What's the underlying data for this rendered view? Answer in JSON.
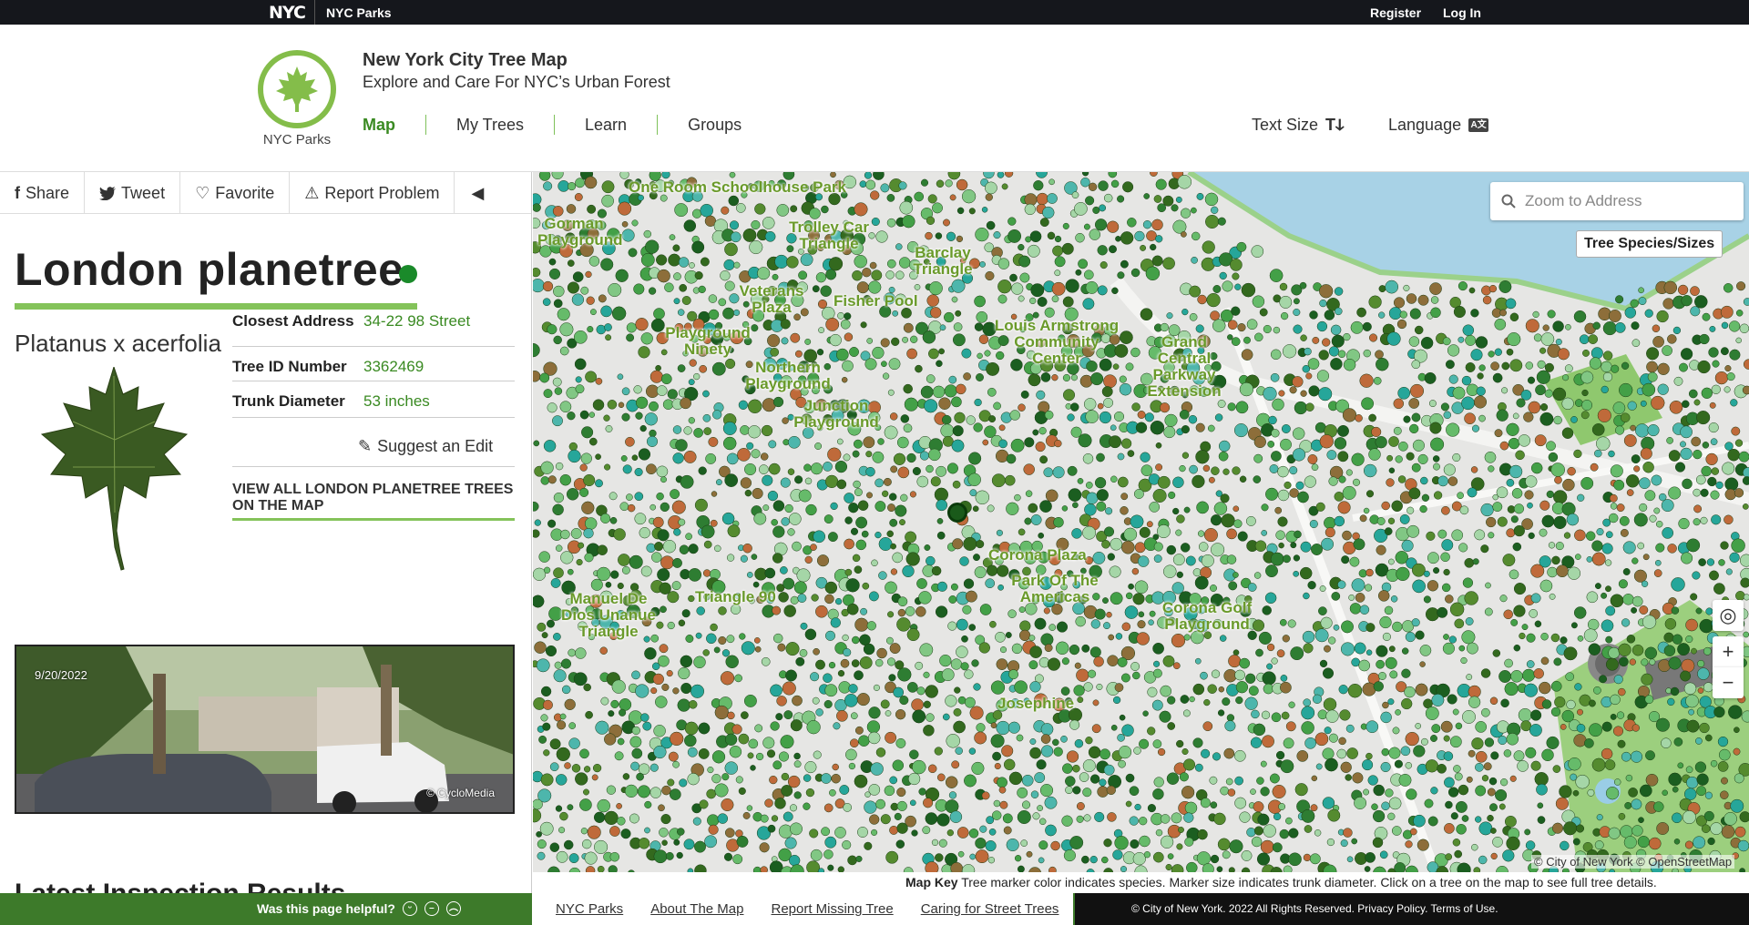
{
  "topbar": {
    "logo": "NYC",
    "parks": "NYC Parks",
    "register": "Register",
    "login": "Log In"
  },
  "header": {
    "logo_text": "NYC Parks",
    "title": "New York City Tree Map",
    "subtitle": "Explore and Care For NYC’s Urban Forest",
    "nav": [
      "Map",
      "My Trees",
      "Learn",
      "Groups"
    ],
    "active_nav": "Map",
    "text_size": "Text Size",
    "text_size_icon": "Tↆ",
    "language": "Language",
    "language_icon": "A文"
  },
  "actions": {
    "share": "Share",
    "tweet": "Tweet",
    "favorite": "Favorite",
    "report": "Report Problem"
  },
  "tree": {
    "common_name": "London planetree",
    "scientific_name": "Platanus x acerfolia",
    "status_color": "#1a8a2a",
    "closest_address_label": "Closest Address",
    "closest_address": "34-22 98 Street",
    "tree_id_label": "Tree ID Number",
    "tree_id": "3362469",
    "trunk_label": "Trunk Diameter",
    "trunk": "53 inches",
    "suggest_edit": "Suggest an Edit",
    "view_all": "VIEW ALL LONDON PLANETREE TREES ON THE MAP",
    "photo_date": "9/20/2022",
    "photo_credit": "© CycloMedia",
    "latest_inspection": "Latest Inspection Results"
  },
  "map": {
    "search_placeholder": "Zoom to Address",
    "species_button": "Tree Species/Sizes",
    "attribution": "© City of New York © OpenStreetMap",
    "labels": [
      {
        "text": "One Room Schoolhouse Park"
      },
      {
        "text": "Gorman Playground"
      },
      {
        "text": "Trolley Car Triangle"
      },
      {
        "text": "Barclay Triangle"
      },
      {
        "text": "Veterans Plaza"
      },
      {
        "text": "Fisher Pool"
      },
      {
        "text": "Playground Ninety"
      },
      {
        "text": "Louis Armstrong Community Center"
      },
      {
        "text": "Grand Central Parkway Extension"
      },
      {
        "text": "Northern Playground"
      },
      {
        "text": "Junction Playground"
      },
      {
        "text": "Corona Plaza"
      },
      {
        "text": "Park Of The Americas"
      },
      {
        "text": "Triangle 90"
      },
      {
        "text": "Manuel De Dios Unanue Triangle"
      },
      {
        "text": "Corona Golf Playground"
      },
      {
        "text": "Josephine"
      }
    ],
    "key_title": "Map Key",
    "key_text": "Tree marker color indicates species. Marker size indicates trunk diameter. Click on a tree on the map to see full tree details."
  },
  "footer": {
    "helpful": "Was this page helpful?",
    "links": [
      "NYC Parks",
      "About The Map",
      "Report Missing Tree",
      "Caring for Street Trees"
    ],
    "copyright": "© City of New York. 2022 All Rights Reserved.  Privacy Policy.  Terms of Use."
  }
}
